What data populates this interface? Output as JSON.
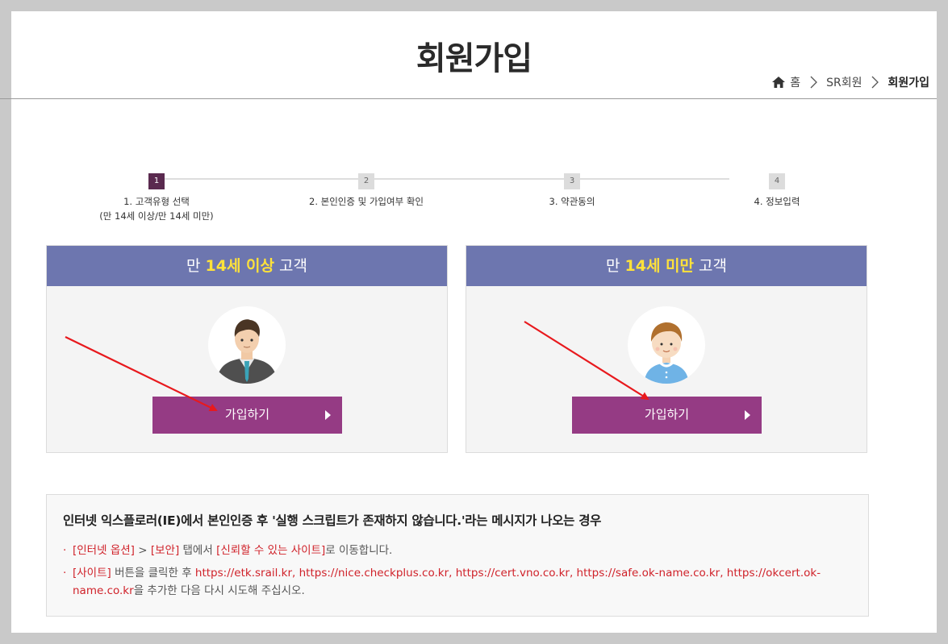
{
  "header": {
    "title": "회원가입",
    "breadcrumb": {
      "home": "홈",
      "section": "SR회원",
      "current": "회원가입"
    }
  },
  "steps": [
    {
      "num": "1",
      "label": "1. 고객유형 선택",
      "sub": "(만 14세 이상/만 14세 미만)",
      "active": true
    },
    {
      "num": "2",
      "label": "2. 본인인증 및 가입여부 확인",
      "sub": "",
      "active": false
    },
    {
      "num": "3",
      "label": "3. 약관동의",
      "sub": "",
      "active": false
    },
    {
      "num": "4",
      "label": "4. 정보입력",
      "sub": "",
      "active": false
    }
  ],
  "cards": [
    {
      "prefix": "만 ",
      "highlight": "14세 이상",
      "suffix": " 고객",
      "button": "가입하기",
      "avatar": "adult-man-avatar"
    },
    {
      "prefix": "만 ",
      "highlight": "14세 미만",
      "suffix": " 고객",
      "button": "가입하기",
      "avatar": "child-avatar"
    }
  ],
  "notice": {
    "title": "인터넷 익스플로러(IE)에서 본인인증 후 '실행 스크립트가 존재하지 않습니다.'라는 메시지가 나오는 경우",
    "items": [
      {
        "bullet": "·",
        "p1": "[인터넷 옵션]",
        "p2": " > ",
        "p3": "[보안]",
        "p4": " 탭에서 ",
        "p5": "[신뢰할 수 있는 사이트]",
        "p6": "로 이동합니다."
      },
      {
        "bullet": "·",
        "p1": "[사이트]",
        "p2": " 버튼을 클릭한 후 ",
        "p3": "https://etk.srail.kr, https://nice.checkplus.co.kr, https://cert.vno.co.kr, https://safe.ok-name.co.kr, https://okcert.ok-name.co.kr",
        "p4": "을 추가한 다음 다시 시도해 주십시오."
      }
    ]
  },
  "colors": {
    "accent_purple": "#953b84",
    "card_header": "#6d76af",
    "highlight_yellow": "#ffe23a",
    "notice_red": "#d0222a",
    "active_step": "#5a2a4f"
  }
}
